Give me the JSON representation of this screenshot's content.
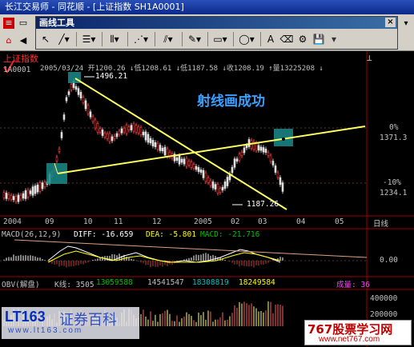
{
  "window": {
    "title": "长江交易师 - 同花顺 - [上证指数 SH1A0001]"
  },
  "draw_toolbar": {
    "title": "画线工具",
    "tools": [
      "pointer-icon",
      "line-icon",
      "horizontal-lines-icon",
      "vertical-lines-icon",
      "fan-lines-icon",
      "parallel-lines-icon",
      "pen-icon",
      "rectangle-icon",
      "ellipse-icon",
      "text-icon",
      "eraser-icon",
      "settings-icon",
      "save-icon"
    ]
  },
  "header": {
    "index_name": "上证指数",
    "code": "1A0001",
    "info": "2005/03/24 开1200.26 ↓低1208.61 ↓低1187.58 ↓收1208.19 ↑量13225208 ↓"
  },
  "annotations": {
    "message": "射线画成功",
    "high_label": "1496.21",
    "low_label": "1187.26"
  },
  "price_axis": {
    "top_pct": "0%",
    "top_val": "1371.3",
    "bottom_pct": "-10%",
    "bottom_val": "1234.1"
  },
  "time_axis": {
    "labels": [
      "2004",
      "09",
      "10",
      "11",
      "12",
      "2005",
      "02",
      "03",
      "04",
      "05"
    ],
    "period": "日线"
  },
  "macd": {
    "title": "MACD(26,12,9)",
    "diff": "DIFF: -16.659",
    "dea": "DEA: -5.801",
    "macd_label": "MACD: -21.716",
    "zero_label": "0.00"
  },
  "volume": {
    "title": "OBV(解盘)",
    "k": "K线: 3505",
    "v1": "13059588",
    "v2": "14541547",
    "v3": "18308819",
    "v4": "18249584",
    "v5": "成量: 36",
    "scale_top": "400000",
    "scale_mid": "200000"
  },
  "watermark": {
    "left": "LT163",
    "left_cn": "证券百科",
    "left_url": "www.lt163.com",
    "right": "767股票学习网",
    "right_url": "www.net767.com"
  },
  "colors": {
    "accent": "#ffff00",
    "text": "#c0c0c0",
    "red": "#ff3030",
    "cyan": "#00c0c0"
  }
}
